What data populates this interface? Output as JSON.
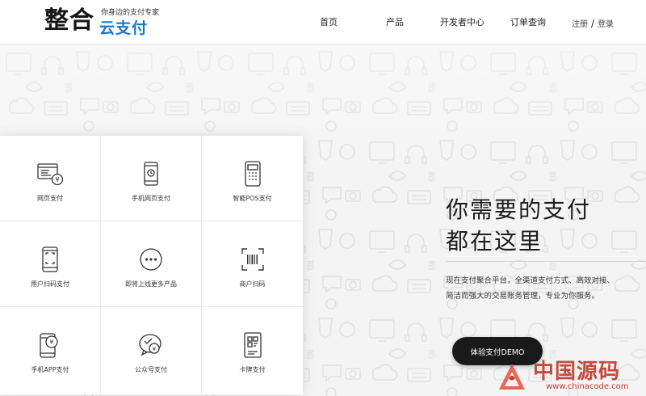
{
  "header": {
    "logo_main": "整合",
    "logo_tagline": "你身边的支付专家",
    "logo_sub": "云支付",
    "nav": [
      {
        "label": "首页"
      },
      {
        "label": "产品"
      },
      {
        "label": "开发者中心"
      },
      {
        "label": "订单查询"
      }
    ],
    "register": "注册",
    "separator": "/",
    "login": "登录"
  },
  "services": [
    {
      "label": "网页支付",
      "icon": "web-pay-icon"
    },
    {
      "label": "手机网页支付",
      "icon": "mobile-web-pay-icon"
    },
    {
      "label": "智能POS支付",
      "icon": "pos-terminal-icon"
    },
    {
      "label": "用户扫码支付",
      "icon": "user-scan-pay-icon"
    },
    {
      "label": "即将上线更多产品",
      "icon": "more-icon"
    },
    {
      "label": "商户扫码",
      "icon": "merchant-scan-icon"
    },
    {
      "label": "手机APP支付",
      "icon": "mobile-app-pay-icon"
    },
    {
      "label": "公众号支付",
      "icon": "official-account-pay-icon"
    },
    {
      "label": "卡牌支付",
      "icon": "card-pay-icon"
    }
  ],
  "hero": {
    "title_line1": "你需要的支付",
    "title_line2": "都在这里",
    "desc_line1": "现在支付聚合平台，全渠道支付方式、高效对接、",
    "desc_line2": "简洁而强大的交易账务管理，专业为你服务。",
    "cta": "体验支付DEMO"
  },
  "watermark": {
    "text": "中国源码",
    "url": "www.chinacode.com"
  },
  "colors": {
    "brand_blue": "#1a78c9",
    "button_dark": "#1a1a1a",
    "watermark_red": "#c0392b"
  }
}
